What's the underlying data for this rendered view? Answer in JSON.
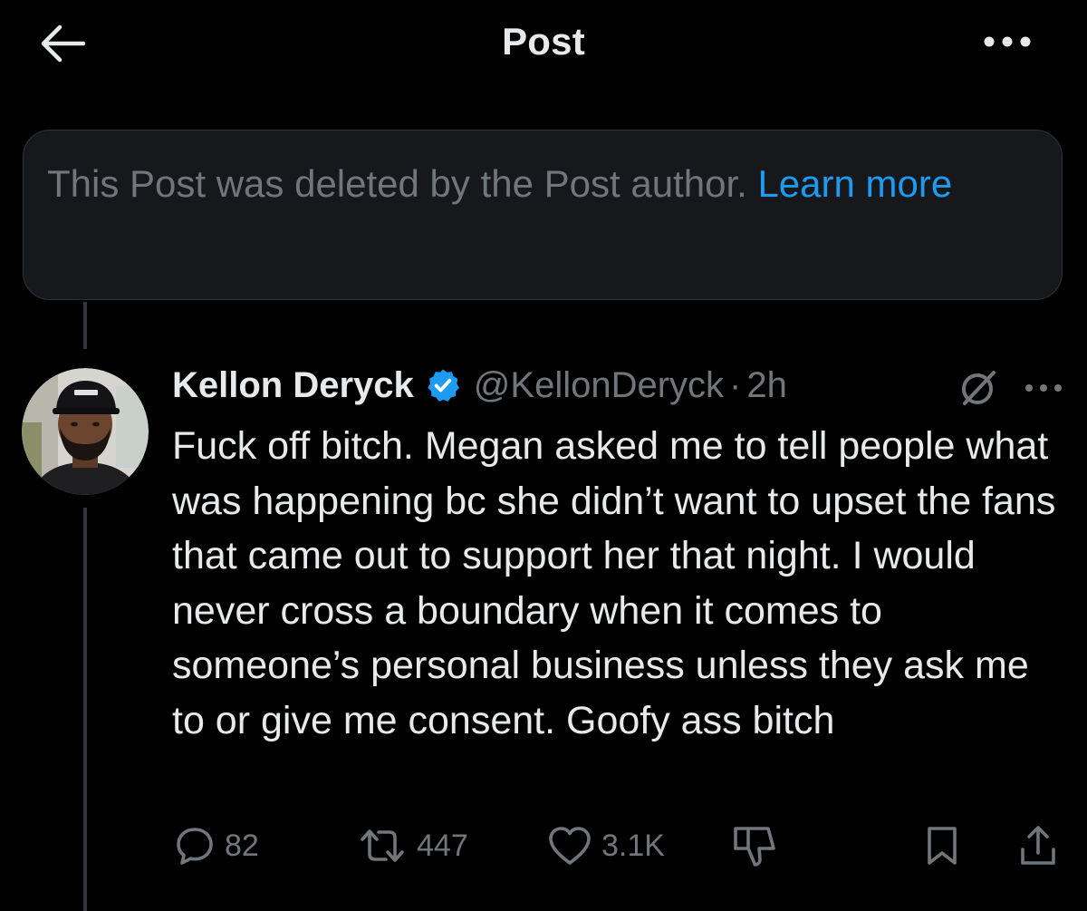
{
  "header": {
    "title": "Post"
  },
  "deleted_notice": {
    "text": "This Post was deleted by the Post author.",
    "link": "Learn more"
  },
  "reply": {
    "author_name": "Kellon Deryck",
    "handle": "@KellonDeryck",
    "separator": "·",
    "time": "2h",
    "body": "Fuck off bitch. Megan asked me to tell people what was happening bc she didn’t want to upset the fans that came out to support her that night. I would never cross a boundary when it comes to someone’s personal business unless they ask me to or give me consent. Goofy ass bitch",
    "stats": {
      "replies": "82",
      "reposts": "447",
      "likes": "3.1K"
    }
  },
  "colors": {
    "background": "#000000",
    "text_primary": "#e7e9ea",
    "text_secondary": "#71767b",
    "accent": "#1d9bf0",
    "notice_bg": "#16181c",
    "border": "#2f3336"
  },
  "icons": {
    "back": "arrow-left-icon",
    "more": "more-horizontal-icon",
    "verified": "verified-badge-icon",
    "grok": "grok-icon",
    "reply": "reply-bubble-icon",
    "repost": "repost-icon",
    "like": "heart-icon",
    "dislike": "thumbs-down-icon",
    "bookmark": "bookmark-icon",
    "share": "share-icon"
  }
}
